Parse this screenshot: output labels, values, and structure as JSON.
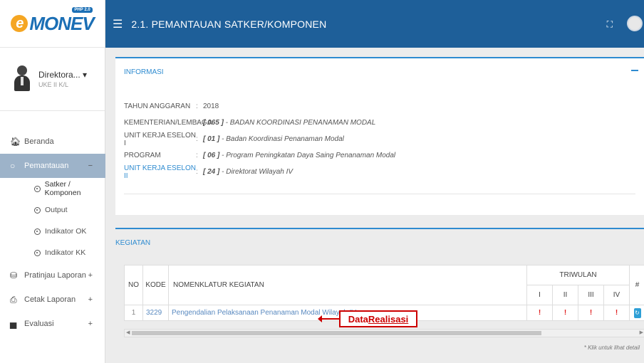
{
  "app": {
    "logo_text": "MONEV",
    "logo_letter": "e",
    "logo_badge": "PHP 2.0",
    "page_title": "2.1. PEMANTAUAN SATKER/KOMPONEN"
  },
  "user": {
    "name": "Direktora...",
    "caret": "▾",
    "role": "UKE II K/L"
  },
  "sidebar": {
    "items": [
      {
        "label": "Beranda",
        "icon": "home-icon"
      },
      {
        "label": "Pemantauan",
        "icon": "circle-icon",
        "suffix": "−"
      },
      {
        "label": "Pratinjau Laporan",
        "icon": "binoculars-icon",
        "suffix": "+"
      },
      {
        "label": "Cetak Laporan",
        "icon": "print-icon",
        "suffix": "+"
      },
      {
        "label": "Evaluasi",
        "icon": "chart-icon",
        "suffix": "+"
      }
    ],
    "subitems": [
      "Satker / Komponen",
      "Output",
      "Indikator OK",
      "Indikator KK"
    ]
  },
  "informasi": {
    "title": "INFORMASI",
    "rows": [
      {
        "key": "TAHUN ANGGARAN",
        "sep": ":",
        "code": "",
        "value": "2018"
      },
      {
        "key": "KEMENTERIAN/LEMBAGA",
        "sep": ":",
        "code": "[ 065 ]",
        "value": " - BADAN KOORDINASI PENANAMAN MODAL"
      },
      {
        "key": "UNIT KERJA ESELON I",
        "sep": ":",
        "code": "[ 01 ]",
        "value": " - Badan Koordinasi Penanaman Modal"
      },
      {
        "key": "PROGRAM",
        "sep": ":",
        "code": "[ 06 ]",
        "value": " - Program Peningkatan Daya Saing Penanaman Modal"
      },
      {
        "key": "UNIT KERJA ESELON II",
        "sep": ":",
        "code": "[ 24 ]",
        "value": " - Direktorat Wilayah IV"
      }
    ]
  },
  "kegiatan": {
    "title": "KEGIATAN",
    "headers": {
      "no": "NO",
      "kode": "KODE",
      "nomenklatur": "NOMENKLATUR KEGIATAN",
      "triwulan": "TRIWULAN",
      "q1": "I",
      "q2": "II",
      "q3": "III",
      "q4": "IV",
      "hash": "#"
    },
    "rows": [
      {
        "no": "1",
        "kode": "3229",
        "nama": "Pengendalian Pelaksanaan Penanaman Modal Wilayah IV",
        "q1": "!",
        "q2": "!",
        "q3": "!",
        "q4": "!",
        "action": "↻"
      }
    ],
    "footnote": "* Klik untuk lihat detail"
  },
  "annotation": {
    "prefix": "Data ",
    "underlined": "Realisasi"
  }
}
